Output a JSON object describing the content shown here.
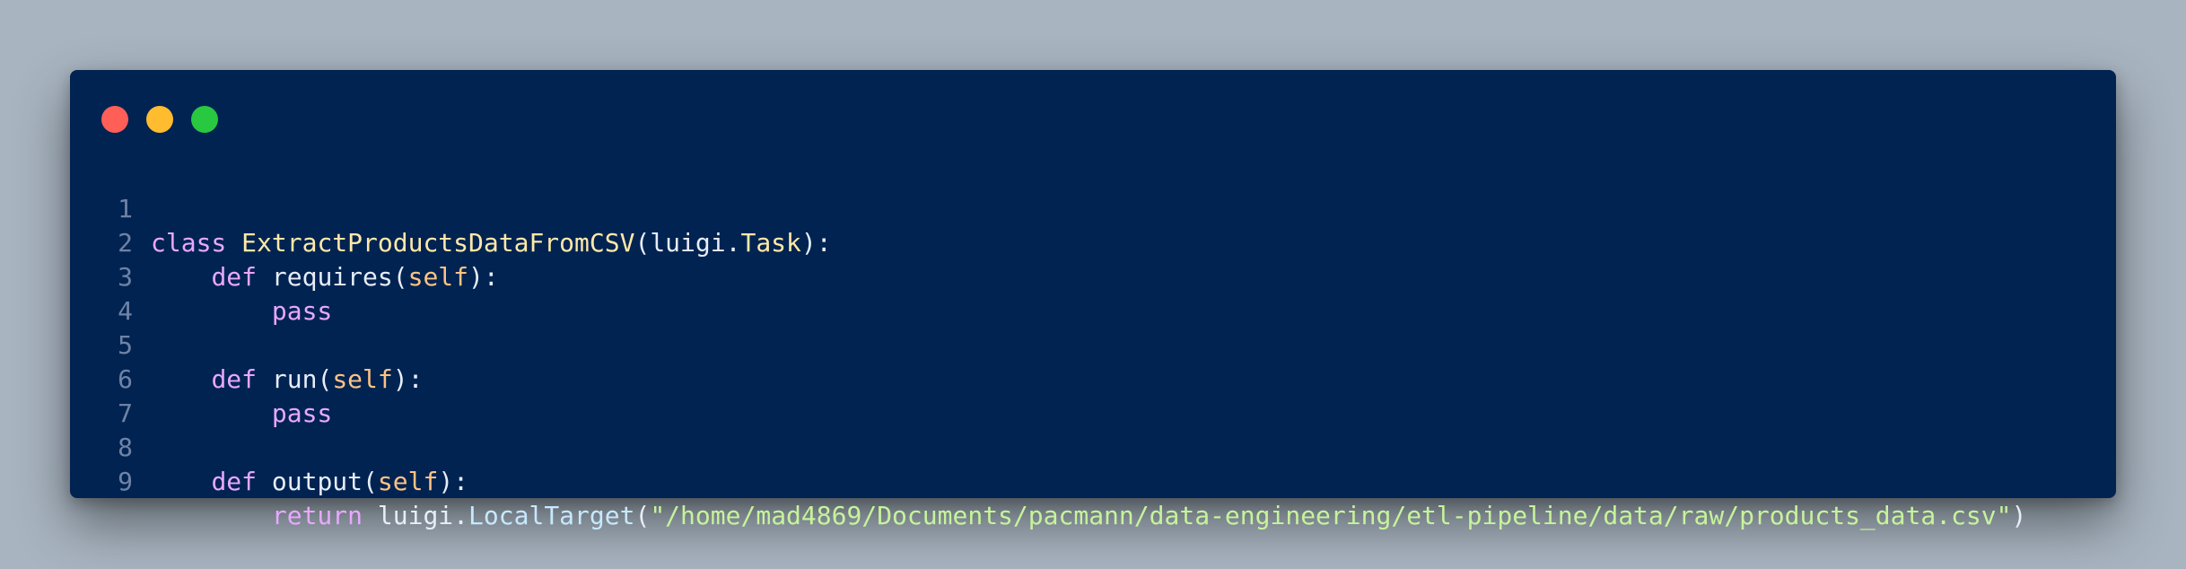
{
  "window": {
    "controls": {
      "close_color": "#ff5f57",
      "minimize_color": "#febc2e",
      "maximize_color": "#28c840"
    }
  },
  "code": {
    "lines": [
      {
        "number": "1",
        "tokens": [
          "class",
          " ",
          "ExtractProductsDataFromCSV",
          "(",
          "luigi",
          ".",
          "Task",
          "):"
        ]
      },
      {
        "number": "2",
        "tokens": [
          "    ",
          "def",
          " ",
          "requires",
          "(",
          "self",
          "):"
        ]
      },
      {
        "number": "3",
        "tokens": [
          "        ",
          "pass"
        ]
      },
      {
        "number": "4",
        "tokens": [
          ""
        ]
      },
      {
        "number": "5",
        "tokens": [
          "    ",
          "def",
          " ",
          "run",
          "(",
          "self",
          "):"
        ]
      },
      {
        "number": "6",
        "tokens": [
          "        ",
          "pass"
        ]
      },
      {
        "number": "7",
        "tokens": [
          ""
        ]
      },
      {
        "number": "8",
        "tokens": [
          "    ",
          "def",
          " ",
          "output",
          "(",
          "self",
          "):"
        ]
      },
      {
        "number": "9",
        "tokens": [
          "        ",
          "return",
          " ",
          "luigi",
          ".",
          "LocalTarget",
          "(",
          "\"/home/mad4869/Documents/pacmann/data-engineering/etl-pipeline/data/raw/products_data.csv\"",
          ")"
        ]
      }
    ]
  }
}
